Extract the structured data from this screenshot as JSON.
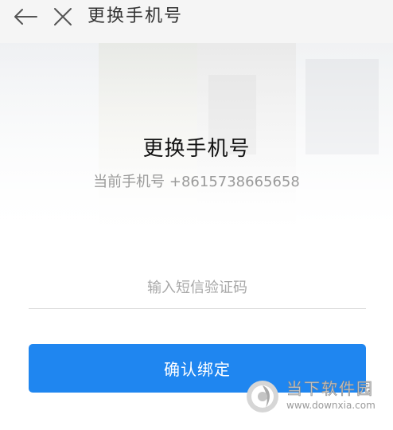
{
  "header": {
    "title": "更换手机号",
    "back_icon": "arrow-left-icon",
    "close_icon": "close-icon"
  },
  "banner": {
    "title": "更换手机号",
    "current_phone_label": "当前手机号 +8615738665658"
  },
  "form": {
    "sms_placeholder": "输入短信验证码",
    "sms_value": "",
    "confirm_label": "确认绑定"
  },
  "watermark": {
    "name": "当下软件园",
    "url": "www.downxia.com"
  },
  "colors": {
    "primary": "#1f86f0",
    "header_bg": "#f5f5f5"
  }
}
